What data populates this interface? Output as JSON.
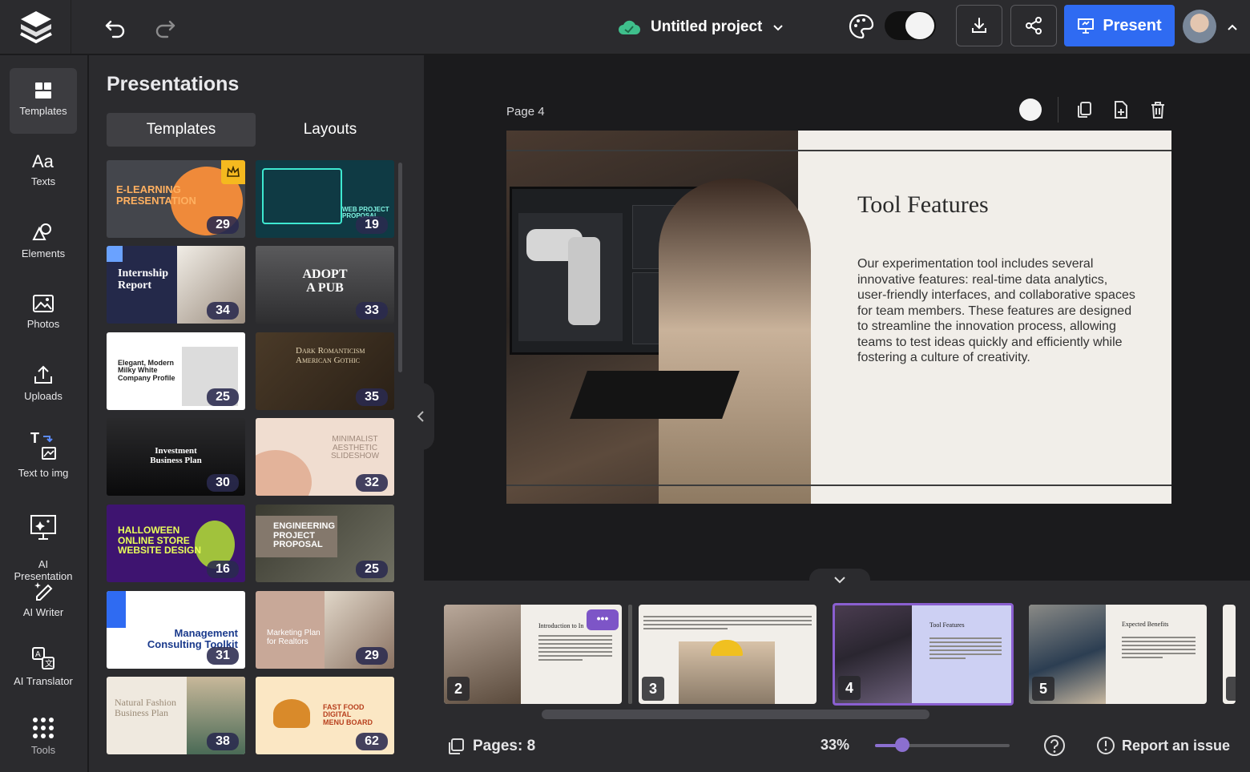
{
  "header": {
    "project_title": "Untitled project",
    "present_label": "Present",
    "colors": {
      "accent": "#2f6bf2",
      "cloud": "#3fbf8c"
    }
  },
  "sidebar": {
    "items": [
      {
        "label": "Templates",
        "icon": "templates-icon"
      },
      {
        "label": "Texts",
        "icon": "text-icon"
      },
      {
        "label": "Elements",
        "icon": "elements-icon"
      },
      {
        "label": "Photos",
        "icon": "photo-icon"
      },
      {
        "label": "Uploads",
        "icon": "upload-icon"
      },
      {
        "label": "Text to img",
        "icon": "text-to-image-icon"
      },
      {
        "label": "AI\nPresentation",
        "icon": "ai-presentation-icon"
      },
      {
        "label": "AI Writer",
        "icon": "ai-writer-icon"
      },
      {
        "label": "AI Translator",
        "icon": "ai-translator-icon"
      },
      {
        "label": "Tools",
        "icon": "grid-icon"
      }
    ]
  },
  "panel": {
    "title": "Presentations",
    "tabs": [
      "Templates",
      "Layouts"
    ],
    "templates": [
      {
        "text": "E-LEARNING\nPRESENTATION",
        "pages": "29"
      },
      {
        "text": "WEB PROJECT\nPROPOSAL",
        "pages": "19"
      },
      {
        "text": "Internship\nReport",
        "pages": "34"
      },
      {
        "text": "ADOPT\nA PUB",
        "pages": "33"
      },
      {
        "text": "Elegant, Modern\nMilky White\nCompany Profile",
        "pages": "25"
      },
      {
        "text": "Dark Romanticism\nAmerican Gothic",
        "pages": "35"
      },
      {
        "text": "Investment\nBusiness Plan",
        "pages": "30"
      },
      {
        "text": "MINIMALIST\nAESTHETIC\nSLIDESHOW",
        "pages": "32"
      },
      {
        "text": "HALLOWEEN\nONLINE STORE\nWEBSITE DESIGN",
        "pages": "16"
      },
      {
        "text": "ENGINEERING\nPROJECT\nPROPOSAL",
        "pages": "25"
      },
      {
        "text": "Management\nConsulting Toolkit",
        "pages": "31"
      },
      {
        "text": "Marketing Plan\nfor Realtors",
        "pages": "29"
      },
      {
        "text": "Natural Fashion\nBusiness Plan",
        "pages": "38"
      },
      {
        "text": "FAST FOOD DIGITAL\nMENU BOARD",
        "pages": "62"
      }
    ]
  },
  "canvas": {
    "page_label": "Page 4",
    "slide": {
      "title": "Tool Features",
      "body": "Our experimentation tool includes several innovative features: real-time data analytics, user-friendly interfaces, and collaborative spaces for team members. These features are designed to streamline the innovation process, allowing teams to test ideas quickly and efficiently while fostering a culture of creativity."
    }
  },
  "thumbnails": [
    {
      "num": "2",
      "title": "Introduction to In"
    },
    {
      "num": "3",
      "title": ""
    },
    {
      "num": "4",
      "title": "Tool Features"
    },
    {
      "num": "5",
      "title": "Expected Benefits"
    }
  ],
  "footer": {
    "pages_label": "Pages: 8",
    "zoom_label": "33%",
    "zoom_fraction": 0.2,
    "report_label": "Report an issue"
  }
}
